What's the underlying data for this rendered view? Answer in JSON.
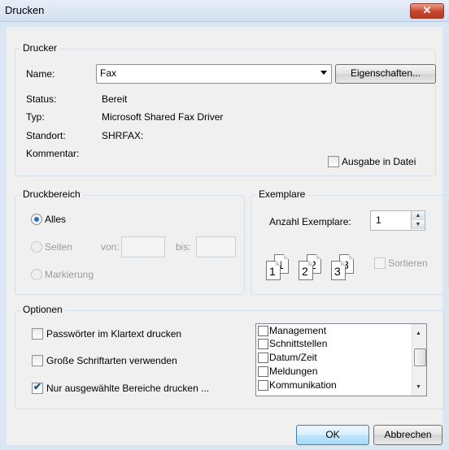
{
  "window": {
    "title": "Drucken",
    "close_glyph": "✕"
  },
  "printer": {
    "group_label": "Drucker",
    "name_label": "Name:",
    "name_value": "Fax",
    "properties_button": "Eigenschaften...",
    "status_label": "Status:",
    "status_value": "Bereit",
    "type_label": "Typ:",
    "type_value": "Microsoft Shared Fax Driver",
    "location_label": "Standort:",
    "location_value": "SHRFAX:",
    "comment_label": "Kommentar:",
    "print_to_file_label": "Ausgabe in Datei",
    "print_to_file_checked": false
  },
  "range": {
    "group_label": "Druckbereich",
    "all_label": "Alles",
    "pages_label": "Seiten",
    "from_label": "von:",
    "to_label": "bis:",
    "selection_label": "Markierung",
    "selected": "all"
  },
  "copies": {
    "group_label": "Exemplare",
    "count_label": "Anzahl Exemplare:",
    "count_value": "1",
    "collate_label": "Sortieren",
    "page_nums": [
      "1",
      "1",
      "2",
      "2",
      "3",
      "3"
    ]
  },
  "options": {
    "group_label": "Optionen",
    "checks": [
      {
        "label": "Passwörter im Klartext drucken",
        "checked": false
      },
      {
        "label": "Große Schriftarten verwenden",
        "checked": false
      },
      {
        "label": "Nur ausgewählte Bereiche drucken ...",
        "checked": true
      }
    ],
    "list_items": [
      "Management",
      "Schnittstellen",
      "Datum/Zeit",
      "Meldungen",
      "Kommunikation"
    ]
  },
  "buttons": {
    "ok": "OK",
    "cancel": "Abbrechen"
  },
  "icons": {
    "dropdown": "chevron-down-icon",
    "spin_up": "▲",
    "spin_down": "▼",
    "scroll_up": "▲",
    "scroll_down": "▼",
    "check": "✔"
  }
}
